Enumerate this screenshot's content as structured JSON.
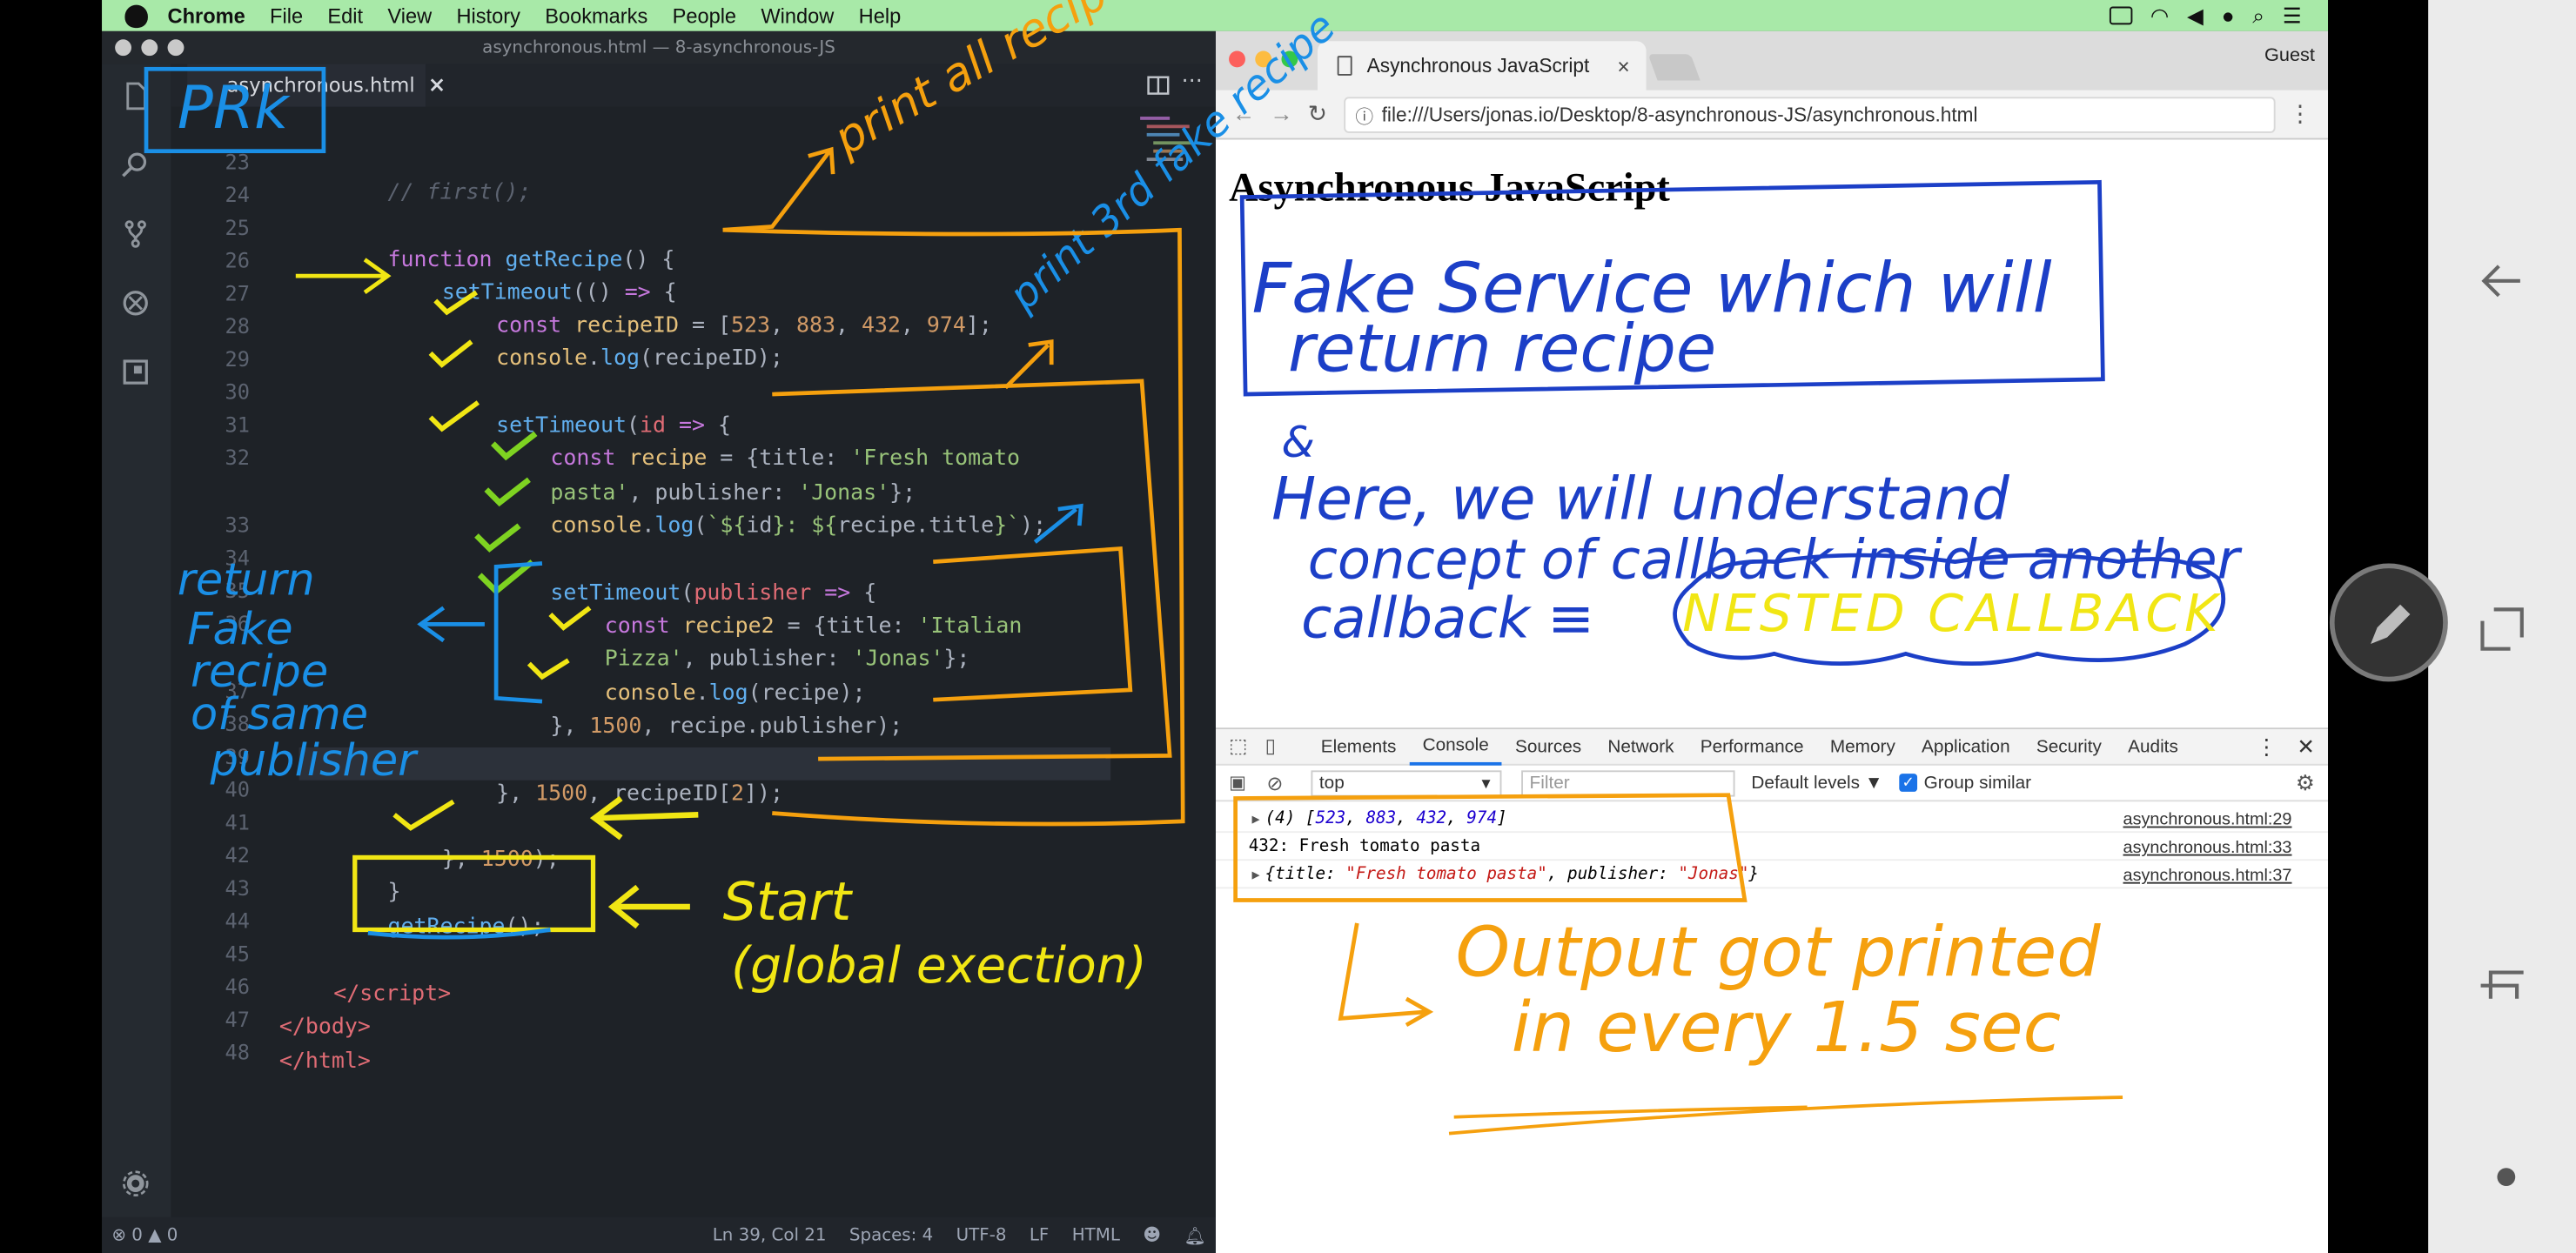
{
  "menubar": {
    "app": "Chrome",
    "items": [
      "File",
      "Edit",
      "View",
      "History",
      "Bookmarks",
      "People",
      "Window",
      "Help"
    ]
  },
  "editor": {
    "window_title": "asynchronous.html — 8-asynchronous-JS",
    "tab_label": "asynchronous.html",
    "status": {
      "problems": "⊗ 0 ▲ 0",
      "position": "Ln 39, Col 21",
      "spaces": "Spaces: 4",
      "encoding": "UTF-8",
      "eol": "LF",
      "language": "HTML"
    },
    "line_numbers": [
      "23",
      "24",
      "25",
      "26",
      "27",
      "28",
      "29",
      "30",
      "31",
      "32",
      "",
      "33",
      "34",
      "35",
      "36",
      "",
      "37",
      "38",
      "39",
      "40",
      "41",
      "42",
      "43",
      "44",
      "45",
      "46",
      "47",
      "48"
    ]
  },
  "browser": {
    "tab_title": "Asynchronous JavaScript",
    "profile": "Guest",
    "url": "file:///Users/jonas.io/Desktop/8-asynchronous-JS/asynchronous.html",
    "page_heading": "Asynchronous JavaScript",
    "devtools": {
      "tabs": [
        "Elements",
        "Console",
        "Sources",
        "Network",
        "Performance",
        "Memory",
        "Application",
        "Security",
        "Audits"
      ],
      "active_tab": "Console",
      "context": "top",
      "filter_placeholder": "Filter",
      "levels": "Default levels ▼",
      "group_similar": "Group similar",
      "source_1": "asynchronous.html:29",
      "source_2": "asynchronous.html:33",
      "source_3": "asynchronous.html:37",
      "line_2": "432: Fresh tomato pasta"
    }
  },
  "annotations": {
    "prk": "PRk",
    "print_all": "print all recipe id",
    "print_3rd": "print 3rd fake recipe",
    "return_fake": "return Fake recipe of same publisher",
    "start": "Start",
    "global_exec": "(global exection)",
    "fake_service_1": "Fake Service which will",
    "fake_service_2": "return recipe",
    "understand_1": "Here, we will understand",
    "understand_2": "concept of callback inside another",
    "understand_3": "callback ≡",
    "nested": "NESTED CALLBACK",
    "output_1": "Output got printed",
    "output_2": "in every 1.5 sec",
    "amp": "&"
  },
  "colors": {
    "menubar": "#a8e9a8",
    "editor_bg": "#1e2227",
    "ink_orange": "#f5a00e",
    "ink_blue": "#1a8fe6",
    "ink_yellow": "#f1e614",
    "ink_green": "#7ed321",
    "ink_navy": "#1c3fc7"
  }
}
